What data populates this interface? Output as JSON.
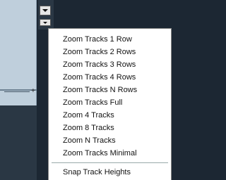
{
  "menu": {
    "items": [
      "Zoom Tracks 1 Row",
      "Zoom Tracks 2 Rows",
      "Zoom Tracks 3 Rows",
      "Zoom Tracks 4 Rows",
      "Zoom Tracks N Rows",
      "Zoom Tracks Full",
      "Zoom 4 Tracks",
      "Zoom 8 Tracks",
      "Zoom N Tracks",
      "Zoom Tracks Minimal"
    ],
    "after_separator": [
      "Snap Track Heights"
    ]
  },
  "zoom_slider": {
    "plus_label": "+"
  },
  "colors": {
    "background": "#1c2733",
    "track_area": "#bfcfdc",
    "menu_background": "#ffffff"
  }
}
